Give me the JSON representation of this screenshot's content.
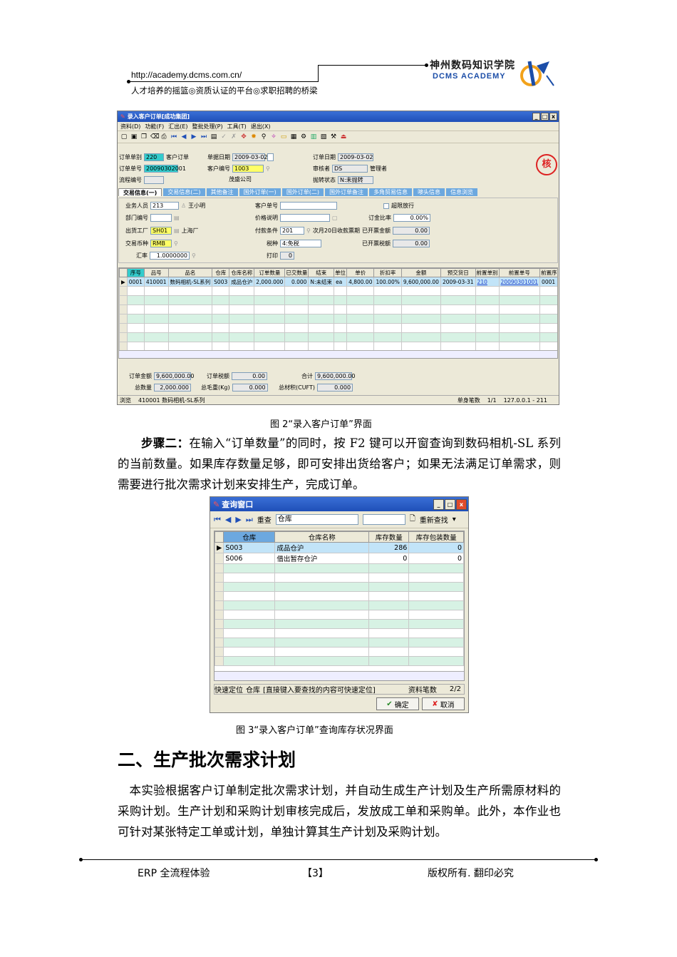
{
  "header": {
    "url": "http://academy.dcms.com.cn/",
    "slogan": "人才培养的摇篮◎资质认证的平台◎求职招聘的桥梁",
    "brand_cn": "神州数码知识学院",
    "brand_en": "DCMS ACADEMY"
  },
  "order_window": {
    "title": "录入客户订单[成功集团]",
    "window_buttons": [
      "_",
      "□",
      "x"
    ],
    "menu": [
      "资料(D)",
      "功能(F)",
      "汇出(E)",
      "整批处理(P)",
      "工具(T)",
      "退出(X)"
    ],
    "fields": {
      "order_type_label": "订单单别",
      "order_type": "220",
      "order_type_name": "客户订单",
      "doc_date_label": "单据日期",
      "doc_date": "2009-03-02",
      "order_date_label": "订单日期",
      "order_date": "2009-03-02",
      "order_no_label": "订单单号",
      "order_no": "20090302001",
      "customer_no_label": "客户编号",
      "customer_no": "1003",
      "customer_name": "茂盛公司",
      "reviewer_label": "审核者",
      "reviewer": "DS",
      "reviewer_name": "管理者",
      "flow_no_label": "流程编号",
      "transfer_status_label": "抛转状态",
      "transfer_status": "N:未抛转",
      "stamp_char": "核"
    },
    "tabs": [
      "交易信息(一)",
      "交易信息(二)",
      "其他备注",
      "国外订单(一)",
      "国外订单(二)",
      "国外订单备注",
      "多角贸易信息",
      "嘜头信息",
      "信息浏览"
    ],
    "trade": {
      "salesperson_label": "业务人员",
      "salesperson": "213",
      "salesperson_name": "王小明",
      "dept_label": "部门编号",
      "factory_label": "出货工厂",
      "factory": "SH01",
      "factory_name": "上海厂",
      "currency_label": "交易币种",
      "currency": "RMB",
      "rate_label": "汇率",
      "rate": "1.0000000",
      "cust_order_label": "客户单号",
      "price_note_label": "价格说明",
      "pay_terms_label": "付款条件",
      "pay_terms": "201",
      "pay_terms_desc": "次月20日收款票期",
      "tax_label": "税种",
      "tax": "4:免税",
      "print_label": "打印",
      "print": "0",
      "over_limit_label": "超限放行",
      "deposit_label": "订金比率",
      "deposit": "0.00%",
      "invoiced_amt_label": "已开票金额",
      "invoiced_amt": "0.00",
      "invoiced_tax_label": "已开票税额",
      "invoiced_tax": "0.00"
    },
    "grid": {
      "headers": [
        "序号",
        "品号",
        "品名",
        "仓库",
        "仓库名称",
        "订单数量",
        "已交数量",
        "结束",
        "单位",
        "单价",
        "折扣率",
        "金额",
        "预交货日",
        "前置单别",
        "前置单号",
        "前置序号"
      ],
      "rows": [
        [
          "0001",
          "410001",
          "数码相机-SL系列",
          "S003",
          "成品仓沪",
          "2,000.000",
          "0.000",
          "N:未结束",
          "ea",
          "4,800.00",
          "100.00%",
          "9,600,000.00",
          "2009-03-31",
          "210",
          "20090301001",
          "0001"
        ]
      ]
    },
    "totals": {
      "order_amt_label": "订单金额",
      "order_amt": "9,600,000.00",
      "order_tax_label": "订单税额",
      "order_tax": "0.00",
      "sum_label": "合计",
      "sum": "9,600,000.00",
      "total_qty_label": "总数量",
      "total_qty": "2,000.000",
      "gross_weight_label": "总毛重(Kg)",
      "gross_weight": "0.000",
      "volume_label": "总材积(CUFT)",
      "volume": "0.000"
    },
    "status": {
      "mode": "浏览",
      "item": "410001 数码相机-SL系列",
      "count_label": "单身笔数",
      "count": "1/1",
      "ip": "127.0.0.1 - 211"
    }
  },
  "caption1": "图 2“录入客户订单”界面",
  "para1": {
    "bold": "步骤二：",
    "text": "在输入“订单数量”的同时，按 F2 键可以开窗查询到数码相机-SL 系列的当前数量。如果库存数量足够，即可安排出货给客户；如果无法满足订单需求，则需要进行批次需求计划来安排生产，完成订单。"
  },
  "query_window": {
    "title": "查询窗口",
    "window_buttons": [
      "_",
      "□",
      "x"
    ],
    "search_label": "重查",
    "search_field": "仓库",
    "refind_label": "重新查找",
    "headers": [
      "仓库",
      "仓库名称",
      "库存数量",
      "库存包装数量"
    ],
    "rows": [
      [
        "S003",
        "成品仓沪",
        "286",
        "0"
      ],
      [
        "S006",
        "借出暂存仓沪",
        "0",
        "0"
      ]
    ],
    "quick_label": "快速定位",
    "quick_field": "仓库",
    "quick_hint": "[直接键入要查找的内容可快速定位]",
    "count_label": "资料笔数",
    "count": "2/2",
    "ok_label": "确定",
    "cancel_label": "取消"
  },
  "caption2": "图 3“录入客户订单”查询库存状况界面",
  "heading": "二、生产批次需求计划",
  "para2": "本实验根据客户订单制定批次需求计划，并自动生成生产计划及生产所需原材料的采购计划。生产计划和采购计划审核完成后，发放成工单和采购单。此外，本作业也可针对某张特定工单或计划，单独计算其生产计划及采购计划。",
  "footer": {
    "left": "ERP 全流程体验",
    "center": "【3】",
    "right": "版权所有. 翻印必究"
  }
}
